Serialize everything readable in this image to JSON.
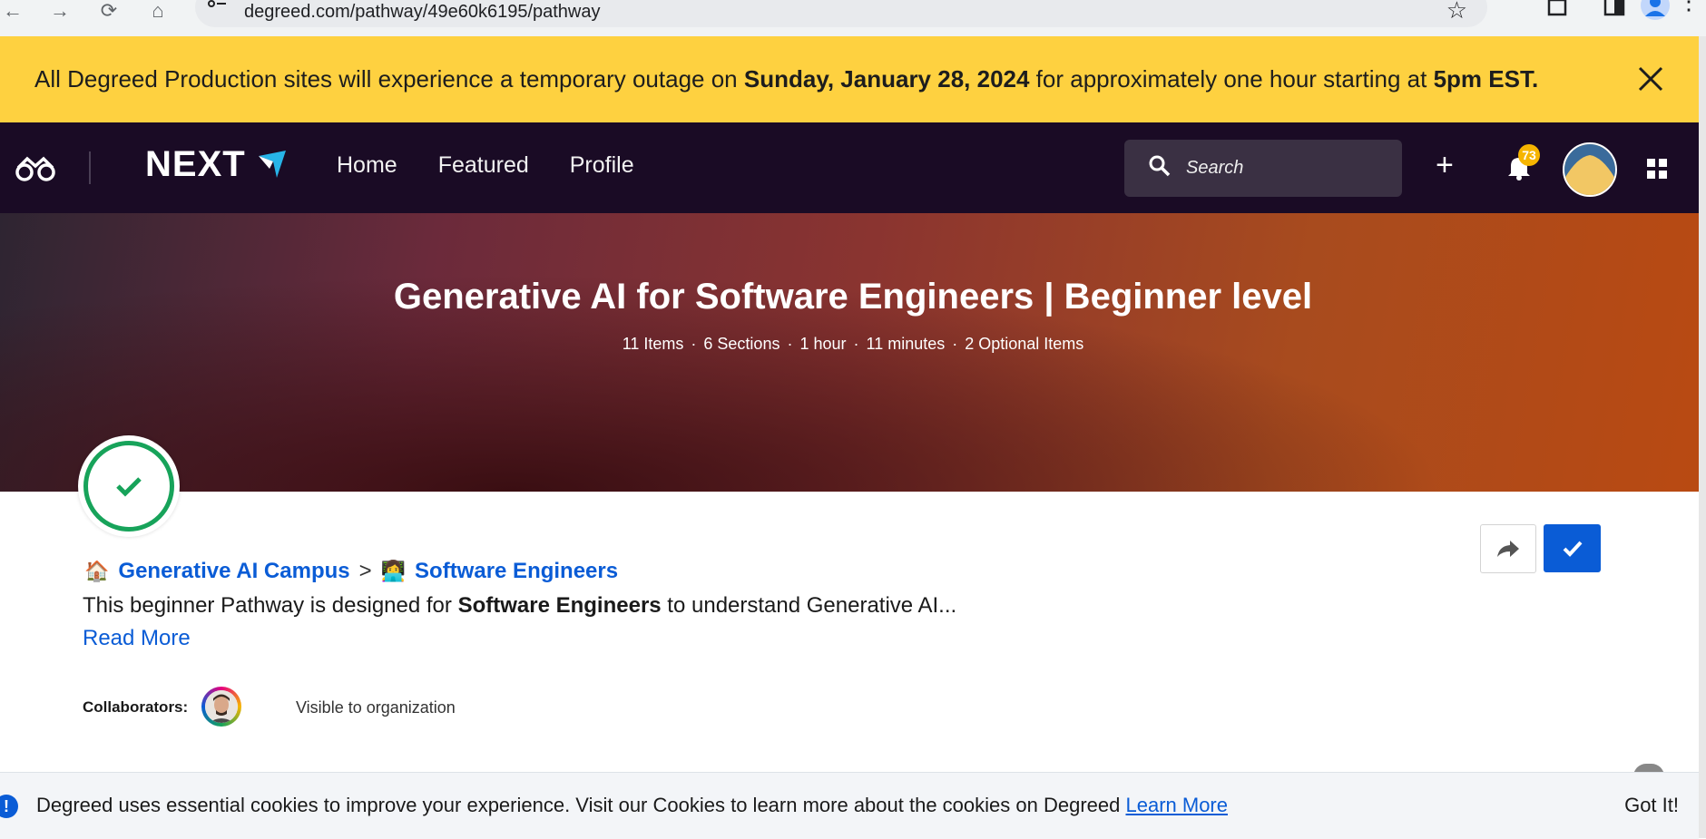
{
  "browser": {
    "url": "degreed.com/pathway/49e60k6195/pathway"
  },
  "banner": {
    "text_1": "All Degreed Production sites will experience a temporary outage on ",
    "date_bold": "Sunday, January 28, 2024",
    "text_2": " for approximately one hour starting at ",
    "time_bold": "5pm EST."
  },
  "nav": {
    "brand": "NEXT",
    "links": [
      "Home",
      "Featured",
      "Profile"
    ],
    "search_placeholder": "Search",
    "notification_count": "73"
  },
  "hero": {
    "title": "Generative AI for Software Engineers | Beginner level",
    "meta": [
      "11 Items",
      "6 Sections",
      "1 hour",
      "11 minutes",
      "2 Optional Items"
    ]
  },
  "pathway": {
    "breadcrumb": [
      {
        "emoji": "🏠",
        "label": "Generative AI Campus"
      },
      {
        "emoji": "👩‍💻",
        "label": "Software Engineers"
      }
    ],
    "breadcrumb_separator": ">",
    "description_1": "This beginner Pathway is designed for ",
    "description_bold": "Software Engineers",
    "description_2": " to understand Generative AI...",
    "read_more": "Read More",
    "collaborators_label": "Collaborators:",
    "visibility": "Visible to organization"
  },
  "cookie": {
    "text": "Degreed uses essential cookies to improve your experience. Visit our Cookies to learn more about the cookies on Degreed ",
    "learn_more": "Learn More",
    "got_it": "Got It!"
  },
  "colors": {
    "banner": "#fed140",
    "nav_bg": "#1a0b25",
    "accent_blue": "#0a5cd6",
    "success_green": "#17a35a"
  }
}
